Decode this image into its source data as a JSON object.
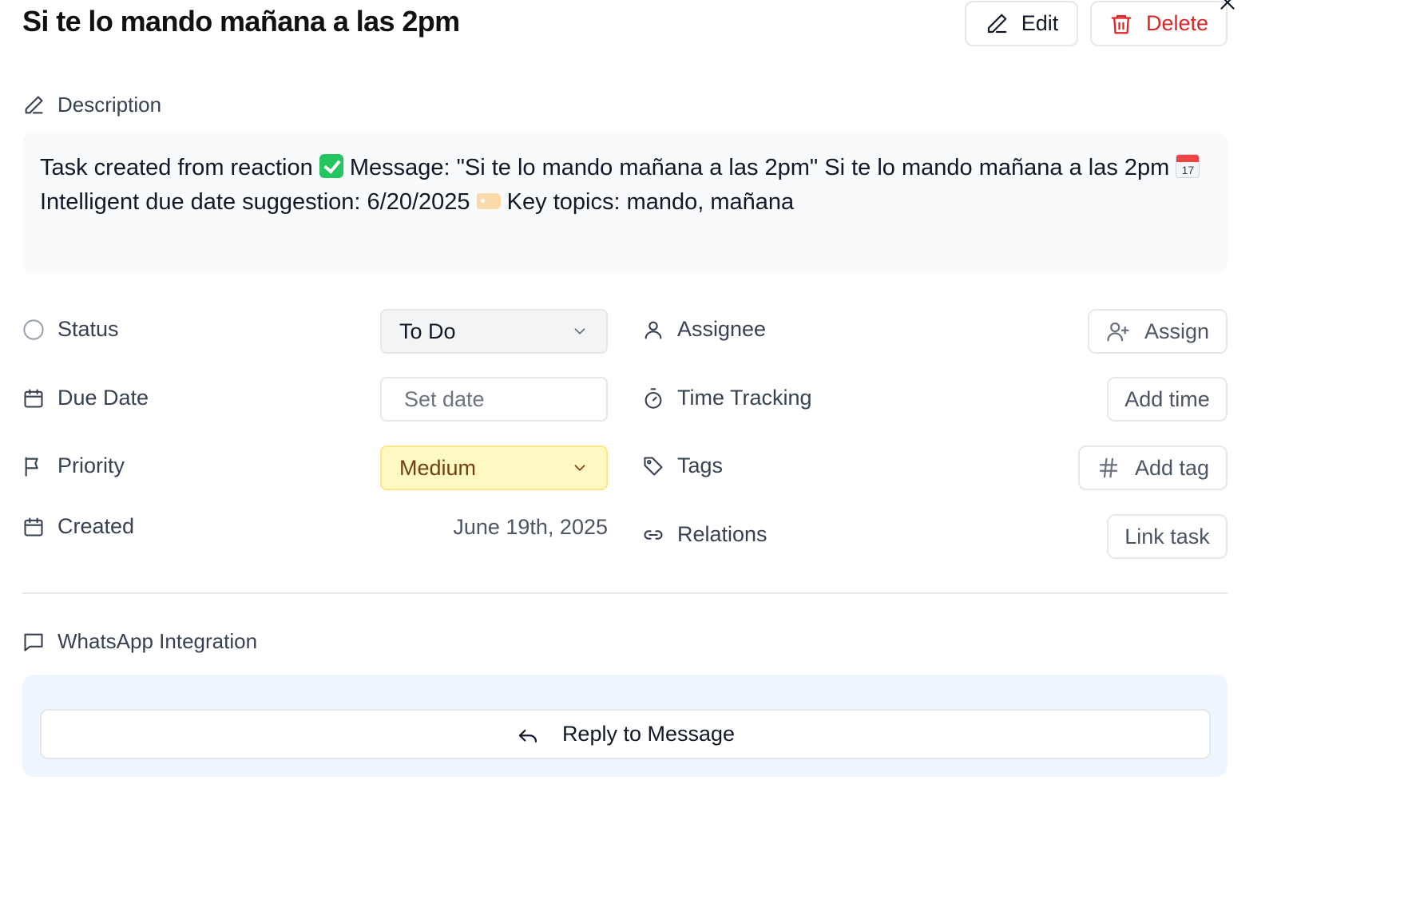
{
  "task": {
    "title": "Si te lo mando mañana a las 2pm"
  },
  "header": {
    "edit_label": "Edit",
    "delete_label": "Delete"
  },
  "description": {
    "heading": "Description",
    "part1": "Task created from reaction ",
    "part2": " Message: \"Si te lo mando mañana a las 2pm\" Si te lo mando mañana a las 2pm ",
    "part3": " Intelligent due date suggestion: 6/20/2025 ",
    "part4": " Key topics: mando, mañana",
    "calendar_emoji_day": "17"
  },
  "fields": {
    "status_label": "Status",
    "status_value": "To Do",
    "due_date_label": "Due Date",
    "due_date_placeholder": "Set date",
    "priority_label": "Priority",
    "priority_value": "Medium",
    "created_label": "Created",
    "created_value": "June 19th, 2025",
    "assignee_label": "Assignee",
    "assign_button": "Assign",
    "time_tracking_label": "Time Tracking",
    "add_time_button": "Add time",
    "tags_label": "Tags",
    "add_tag_button": "Add tag",
    "relations_label": "Relations",
    "link_task_button": "Link task"
  },
  "whatsapp": {
    "heading": "WhatsApp Integration",
    "reply_button": "Reply to Message"
  },
  "colors": {
    "delete": "#dc2626",
    "priority_bg": "#fef9c3",
    "priority_text": "#713f12",
    "whatsapp_panel_bg": "#eff6ff"
  }
}
